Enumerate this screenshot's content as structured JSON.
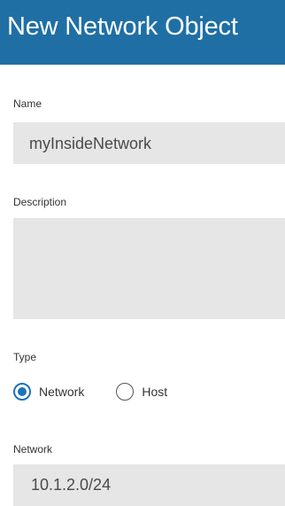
{
  "dialog": {
    "title": "New Network Object"
  },
  "form": {
    "name": {
      "label": "Name",
      "value": "myInsideNetwork"
    },
    "description": {
      "label": "Description",
      "value": ""
    },
    "type": {
      "label": "Type",
      "options": [
        {
          "label": "Network",
          "selected": true
        },
        {
          "label": "Host",
          "selected": false
        }
      ]
    },
    "network": {
      "label": "Network",
      "value": "10.1.2.0/24"
    }
  },
  "colors": {
    "header_bg": "#1f6fa5",
    "field_bg": "#e6e6e6",
    "radio_accent": "#1f73b7"
  }
}
